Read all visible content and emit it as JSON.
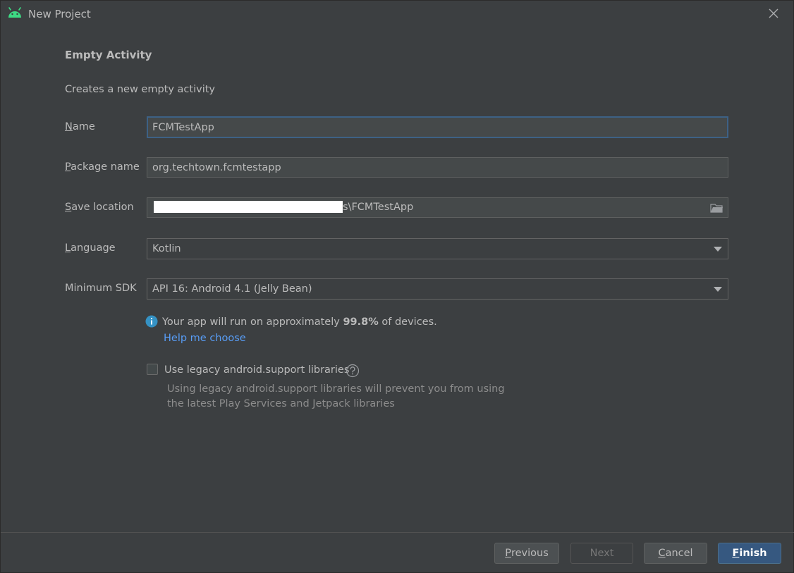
{
  "window": {
    "title": "New Project",
    "icon": "android-icon",
    "close_icon": "close-icon"
  },
  "page": {
    "heading": "Empty Activity",
    "subheading": "Creates a new empty activity"
  },
  "form": {
    "name": {
      "label_mnemonic": "N",
      "label_rest": "ame",
      "value": "FCMTestApp"
    },
    "package": {
      "label_mnemonic": "P",
      "label_rest": "ackage name",
      "value": "org.techtown.fcmtestapp"
    },
    "save_location": {
      "label_mnemonic": "S",
      "label_rest": "ave location",
      "value_suffix": "s\\FCMTestApp",
      "icon": "folder-icon"
    },
    "language": {
      "label_mnemonic": "L",
      "label_rest": "anguage",
      "selected": "Kotlin"
    },
    "min_sdk": {
      "label": "Minimum SDK",
      "selected": "API 16: Android 4.1 (Jelly Bean)"
    }
  },
  "info": {
    "icon": "info-icon",
    "text_before": "Your app will run on approximately ",
    "percent": "99.8%",
    "text_after": " of devices.",
    "link": "Help me choose"
  },
  "legacy": {
    "checked": false,
    "label": "Use legacy android.support libraries",
    "help_icon": "question-icon",
    "note_line1": "Using legacy android.support libraries will prevent you from using",
    "note_line2": "the latest Play Services and Jetpack libraries"
  },
  "buttons": {
    "previous": {
      "mnemonic": "P",
      "rest": "revious"
    },
    "next": {
      "label": "Next"
    },
    "cancel": {
      "mnemonic": "C",
      "rest": "ancel"
    },
    "finish": {
      "mnemonic": "F",
      "rest": "inish"
    }
  },
  "colors": {
    "background": "#3c3f41",
    "link": "#589df6",
    "primary_button": "#365880",
    "focus_border": "#3d6185",
    "android_green": "#3ddc84",
    "info_blue": "#3592c4"
  }
}
